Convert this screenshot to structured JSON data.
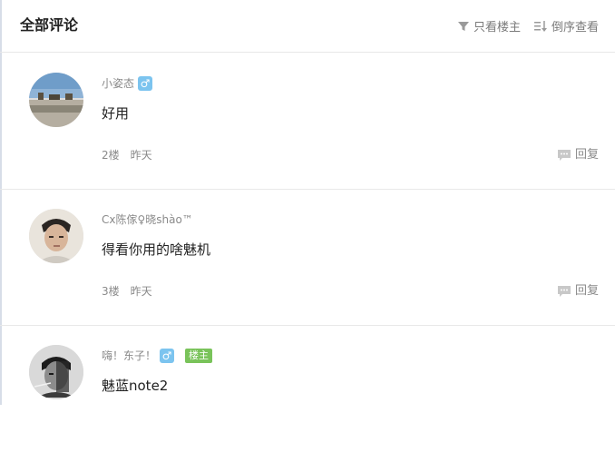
{
  "header": {
    "title": "全部评论",
    "filter_label": "只看楼主",
    "sort_label": "倒序查看"
  },
  "comments": [
    {
      "username": "小姿态",
      "gender_icon": "♂",
      "text": "好用",
      "floor": "2楼",
      "time": "昨天",
      "reply_label": "回复"
    },
    {
      "username": "Cx陈傢♀晓shào™",
      "text": "得看你用的啥魅机",
      "floor": "3楼",
      "time": "昨天",
      "reply_label": "回复"
    },
    {
      "username": "嗨！东子！",
      "gender_icon": "♂",
      "badge": "楼主",
      "text": "魅蓝note2"
    }
  ],
  "colors": {
    "gender_badge": "#7cc4ef",
    "host_badge": "#79c35a",
    "muted_text": "#8a8a8a"
  }
}
